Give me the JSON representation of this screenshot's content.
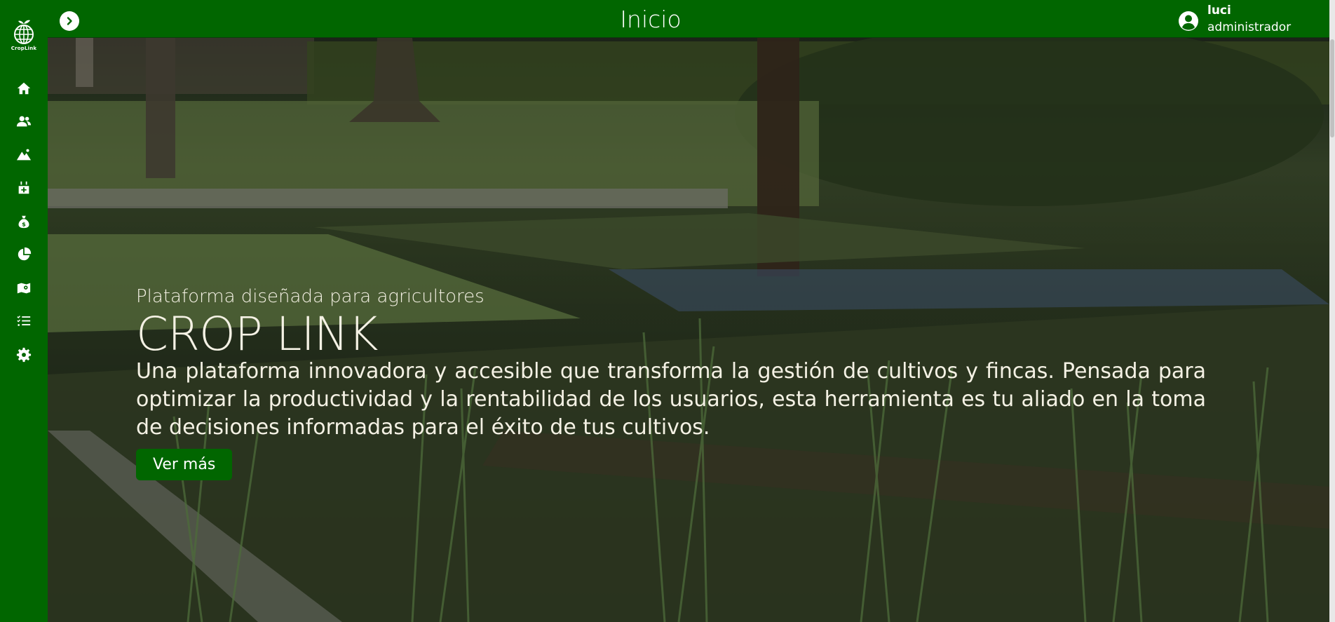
{
  "app": {
    "logo_text": "CropLink"
  },
  "sidebar": {
    "items": [
      {
        "name": "home-icon"
      },
      {
        "name": "users-icon"
      },
      {
        "name": "mountain-icon"
      },
      {
        "name": "calendar-plus-icon"
      },
      {
        "name": "money-bag-icon"
      },
      {
        "name": "pie-chart-icon"
      },
      {
        "name": "map-icon"
      },
      {
        "name": "checklist-icon"
      },
      {
        "name": "gear-icon"
      }
    ]
  },
  "header": {
    "title": "Inicio",
    "user": {
      "name": "luci",
      "role": "administrador"
    }
  },
  "hero": {
    "subtitle": "Plataforma diseñada para agricultores",
    "title": "CROP LINK",
    "description": "Una plataforma innovadora y accesible que transforma la gestión de cultivos y fincas. Pensada para optimizar la productividad y la rentabilidad de los usuarios, esta herramienta es tu aliado en la toma de decisiones informadas para el éxito de tus cultivos.",
    "button_label": "Ver más"
  },
  "colors": {
    "brand_green": "#016600",
    "text_light": "#f4f1e4"
  }
}
